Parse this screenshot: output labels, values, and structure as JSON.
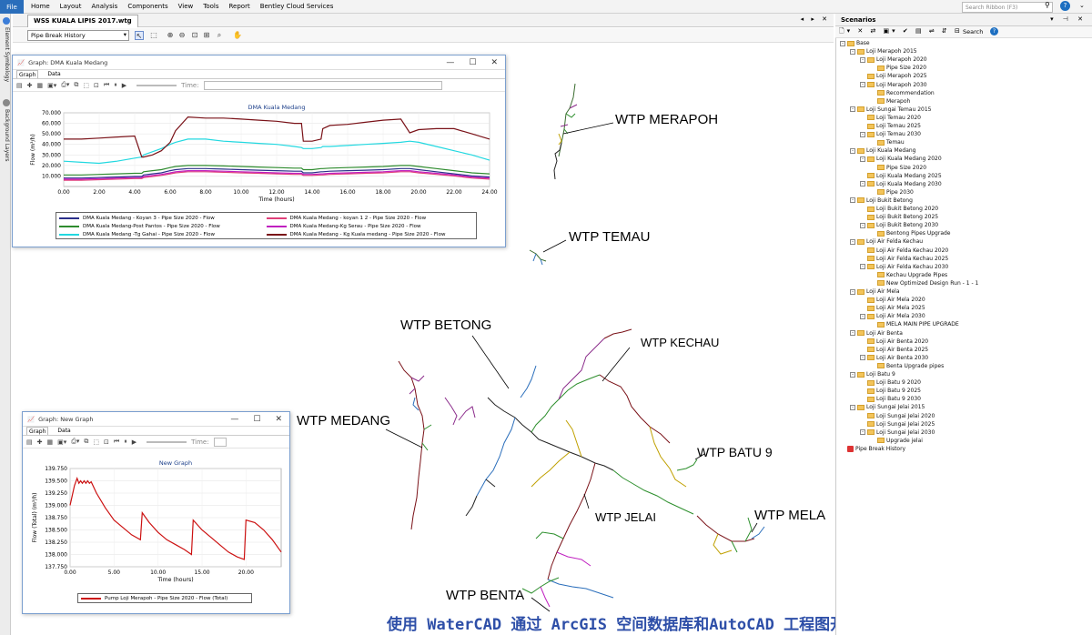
{
  "ribbon": {
    "file": "File",
    "menus": [
      "Home",
      "Layout",
      "Analysis",
      "Components",
      "View",
      "Tools",
      "Report",
      "Bentley Cloud Services"
    ],
    "search_placeholder": "Search Ribbon (F3)",
    "help": "?"
  },
  "left_tabs": [
    "Element Symbology",
    "Background Layers"
  ],
  "document": {
    "tab_title": "WSS KUALA LIPIS 2017.wtg",
    "scenario_select": "Pipe Break History"
  },
  "network_labels": {
    "merapoh": "WTP MERAPOH",
    "temau": "WTP TEMAU",
    "betong": "WTP BETONG",
    "kechau": "WTP KECHAU",
    "medang": "WTP MEDANG",
    "batu9": "WTP BATU 9",
    "jelai": "WTP JELAI",
    "mela": "WTP MELA",
    "benta": "WTP BENTA"
  },
  "caption": "使用 WaterCAD 通过 ArcGIS 空间数据库和AutoCAD 工程图开发出了水力管网",
  "graph1": {
    "window_title": "Graph: DMA Kuala Medang",
    "tabs": [
      "Graph",
      "Data"
    ],
    "time_label": "Time:",
    "chart_data": {
      "type": "line",
      "title": "DMA Kuala Medang",
      "xlabel": "Time (hours)",
      "ylabel": "Flow (m³/h)",
      "xlim": [
        0,
        24
      ],
      "ylim": [
        0,
        70
      ],
      "x_ticks": [
        "0.00",
        "2.00",
        "4.00",
        "6.00",
        "8.00",
        "10.00",
        "12.00",
        "14.00",
        "16.00",
        "18.00",
        "20.00",
        "22.00",
        "24.00"
      ],
      "y_ticks": [
        "10.000",
        "20.000",
        "30.000",
        "40.000",
        "50.000",
        "60.000",
        "70.000"
      ],
      "x": [
        0,
        1,
        2,
        3,
        4,
        4.4,
        4.5,
        5,
        5.5,
        6,
        6.3,
        7,
        8,
        9,
        10,
        11,
        12,
        13,
        13.4,
        13.5,
        14,
        14.5,
        14.6,
        15,
        16,
        17,
        18,
        19,
        19.5,
        20,
        21,
        22,
        23,
        24
      ],
      "series": [
        {
          "name": "DMA Kuala Medang - Koyan 3 - Pipe Size 2020 - Flow",
          "color": "#2b2f8a",
          "values": [
            8,
            8,
            8.5,
            9,
            9.5,
            9.5,
            11,
            12,
            13,
            15,
            16,
            17,
            17,
            16.5,
            16,
            15.5,
            15,
            14.5,
            14.5,
            13,
            13,
            14,
            14,
            14.5,
            15,
            15.5,
            16,
            17,
            17,
            16,
            14,
            12,
            10,
            9
          ]
        },
        {
          "name": "DMA Kuala Medang-Post Pantos - Pipe Size 2020 - Flow",
          "color": "#2e8b2e",
          "values": [
            11,
            11,
            11.5,
            12,
            12.5,
            12.5,
            14,
            15,
            16,
            18,
            19,
            20,
            20,
            19.5,
            19,
            18.5,
            18,
            17.5,
            17.5,
            16,
            16,
            17,
            17,
            17.5,
            18,
            18.5,
            19,
            20,
            20,
            19,
            17,
            15,
            13,
            12
          ]
        },
        {
          "name": "DMA Kuala Medang -Tg Gahai - Pipe Size 2020 - Flow",
          "color": "#22d8e0",
          "values": [
            24,
            23,
            22,
            24,
            27,
            28,
            30,
            33,
            36,
            40,
            42,
            45,
            45,
            43,
            42,
            41,
            40,
            38,
            37,
            36,
            36,
            37,
            38,
            38,
            39,
            40,
            41,
            42,
            43,
            42,
            38,
            34,
            30,
            25
          ]
        },
        {
          "name": "DMA Kuala Medang - koyan 1 2 - Pipe Size 2020 - Flow",
          "color": "#e0407a",
          "values": [
            6,
            6,
            6.5,
            7,
            7.5,
            7.5,
            8.5,
            9.5,
            10.5,
            12,
            13,
            14,
            14,
            13.5,
            13,
            12.5,
            12,
            11.5,
            11.5,
            10.5,
            10.5,
            11,
            11,
            11.5,
            12,
            12.5,
            13,
            14,
            14,
            13,
            11.5,
            10,
            8,
            7
          ]
        },
        {
          "name": "DMA Kuala Medang-Kg Serau - Pipe Size 2020 - Flow",
          "color": "#c020c0",
          "values": [
            7,
            7,
            7.5,
            8,
            8.5,
            8.5,
            9.5,
            10.5,
            11.5,
            13,
            14,
            15,
            15,
            14.5,
            14,
            13.5,
            13,
            12.5,
            12.5,
            11.5,
            11.5,
            12,
            12,
            12.5,
            13,
            13.5,
            14,
            15,
            15,
            14,
            12.5,
            11,
            9,
            8
          ]
        },
        {
          "name": "DMA Kuala Medang - Kg Kuala medang - Pipe Size 2020 - Flow",
          "color": "#7a1218",
          "values": [
            45,
            45,
            46,
            47,
            48,
            28,
            28,
            30,
            34,
            42,
            53,
            66,
            65,
            65,
            64,
            63,
            62,
            60,
            60,
            43,
            43,
            45,
            55,
            58,
            59,
            61,
            63,
            64,
            51,
            54,
            55,
            55,
            50,
            45
          ]
        }
      ]
    }
  },
  "graph2": {
    "window_title": "Graph: New Graph",
    "tabs": [
      "Graph",
      "Data"
    ],
    "time_label": "Time:",
    "chart_data": {
      "type": "line",
      "title": "New Graph",
      "xlabel": "Time (hours)",
      "ylabel": "Flow (Total) (m³/h)",
      "xlim": [
        0,
        24
      ],
      "ylim": [
        137.75,
        139.75
      ],
      "x_ticks": [
        "0.00",
        "5.00",
        "10.00",
        "15.00",
        "20.00"
      ],
      "y_ticks": [
        "137.750",
        "138.000",
        "138.250",
        "138.500",
        "138.750",
        "139.000",
        "139.250",
        "139.500",
        "139.750"
      ],
      "x": [
        0,
        0.5,
        0.8,
        1,
        1.2,
        1.4,
        1.6,
        1.8,
        2,
        2.2,
        2.4,
        3,
        4,
        5,
        6,
        7,
        8,
        8.2,
        9,
        10,
        11,
        12,
        13,
        13.8,
        14,
        15,
        16,
        17,
        18,
        19,
        19.8,
        20,
        21,
        22,
        23,
        24
      ],
      "series": [
        {
          "name": "Pump Loji Merapoh - Pipe Size 2020 - Flow (Total)",
          "color": "#cc1111",
          "values": [
            139.0,
            139.4,
            139.55,
            139.45,
            139.5,
            139.45,
            139.5,
            139.45,
            139.5,
            139.45,
            139.48,
            139.25,
            138.95,
            138.7,
            138.55,
            138.4,
            138.3,
            138.85,
            138.65,
            138.45,
            138.3,
            138.2,
            138.1,
            138.0,
            138.7,
            138.5,
            138.35,
            138.2,
            138.05,
            137.95,
            137.9,
            138.7,
            138.65,
            138.5,
            138.3,
            138.05
          ]
        }
      ]
    }
  },
  "scenarios": {
    "title": "Scenarios",
    "search_label": "Search",
    "tree": [
      {
        "level": 0,
        "label": "Base",
        "exp": "-"
      },
      {
        "level": 1,
        "label": "Loji Merapoh 2015",
        "exp": "-"
      },
      {
        "level": 2,
        "label": "Loji Merapoh 2020",
        "exp": "-"
      },
      {
        "level": 3,
        "label": "Pipe Size 2020",
        "exp": ""
      },
      {
        "level": 2,
        "label": "Loji Merapoh 2025",
        "exp": ""
      },
      {
        "level": 2,
        "label": "Loji Merapoh 2030",
        "exp": "-"
      },
      {
        "level": 3,
        "label": "Recommendation",
        "exp": ""
      },
      {
        "level": 3,
        "label": "Merapoh",
        "exp": ""
      },
      {
        "level": 1,
        "label": "Loji Sungai Temau 2015",
        "exp": "-"
      },
      {
        "level": 2,
        "label": "Loji Temau 2020",
        "exp": ""
      },
      {
        "level": 2,
        "label": "Loji Temau 2025",
        "exp": ""
      },
      {
        "level": 2,
        "label": "Loji Temau 2030",
        "exp": "-"
      },
      {
        "level": 3,
        "label": "Temau",
        "exp": ""
      },
      {
        "level": 1,
        "label": "Loji Kuala Medang",
        "exp": "-"
      },
      {
        "level": 2,
        "label": "Loji Kuala Medang 2020",
        "exp": "-"
      },
      {
        "level": 3,
        "label": "Pipe Size 2020",
        "exp": ""
      },
      {
        "level": 2,
        "label": "Loji Kuala Medang 2025",
        "exp": ""
      },
      {
        "level": 2,
        "label": "Loji Kuala Medang 2030",
        "exp": "-"
      },
      {
        "level": 3,
        "label": "Pipe 2030",
        "exp": ""
      },
      {
        "level": 1,
        "label": "Loji Bukit Betong",
        "exp": "-"
      },
      {
        "level": 2,
        "label": "Loji Bukit Betong 2020",
        "exp": ""
      },
      {
        "level": 2,
        "label": "Loji Bukit Betong 2025",
        "exp": ""
      },
      {
        "level": 2,
        "label": "Loji Bukit Betong 2030",
        "exp": "-"
      },
      {
        "level": 3,
        "label": "Bentong Pipes Upgrade",
        "exp": ""
      },
      {
        "level": 1,
        "label": "Loji Air Felda Kechau",
        "exp": "-"
      },
      {
        "level": 2,
        "label": "Loji Air Felda Kechau 2020",
        "exp": ""
      },
      {
        "level": 2,
        "label": "Loji Air Felda Kechau 2025",
        "exp": ""
      },
      {
        "level": 2,
        "label": "Loji Air Felda Kechau 2030",
        "exp": "-"
      },
      {
        "level": 3,
        "label": "Kechau Upgrade Pipes",
        "exp": ""
      },
      {
        "level": 3,
        "label": "New Optimized Design Run - 1 - 1",
        "exp": ""
      },
      {
        "level": 1,
        "label": "Loji Air Mela",
        "exp": "-"
      },
      {
        "level": 2,
        "label": "Loji Air Mela 2020",
        "exp": ""
      },
      {
        "level": 2,
        "label": "Loji Air Mela 2025",
        "exp": ""
      },
      {
        "level": 2,
        "label": "Loji Air Mela 2030",
        "exp": "-"
      },
      {
        "level": 3,
        "label": "MELA MAIN PIPE UPGRADE",
        "exp": ""
      },
      {
        "level": 1,
        "label": "Loji Air Benta",
        "exp": "-"
      },
      {
        "level": 2,
        "label": "Loji Air Benta 2020",
        "exp": ""
      },
      {
        "level": 2,
        "label": "Loji Air Benta 2025",
        "exp": ""
      },
      {
        "level": 2,
        "label": "Loji Air Benta 2030",
        "exp": "-"
      },
      {
        "level": 3,
        "label": "Benta Upgrade pipes",
        "exp": ""
      },
      {
        "level": 1,
        "label": "Loji Batu 9",
        "exp": "-"
      },
      {
        "level": 2,
        "label": "Loji Batu 9 2020",
        "exp": ""
      },
      {
        "level": 2,
        "label": "Loji Batu 9 2025",
        "exp": ""
      },
      {
        "level": 2,
        "label": "Loji Batu 9 2030",
        "exp": ""
      },
      {
        "level": 1,
        "label": "Loji Sungai Jelai 2015",
        "exp": "-"
      },
      {
        "level": 2,
        "label": "Loji Sungai Jelai 2020",
        "exp": ""
      },
      {
        "level": 2,
        "label": "Loji Sungai Jelai 2025",
        "exp": ""
      },
      {
        "level": 2,
        "label": "Loji Sungai Jelai 2030",
        "exp": "-"
      },
      {
        "level": 3,
        "label": "Upgrade jelai",
        "exp": ""
      },
      {
        "level": 0,
        "label": "Pipe Break History",
        "exp": "",
        "active": true
      }
    ]
  }
}
